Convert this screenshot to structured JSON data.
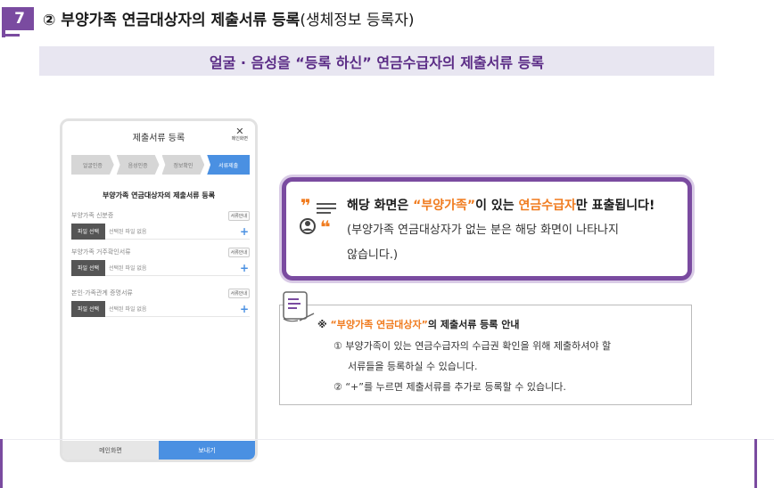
{
  "header": {
    "step_number": "7",
    "title": "② 부양가족 연금대상자의 제출서류 등록",
    "title_suffix": "(생체정보 등록자)"
  },
  "banner": {
    "text": "얼굴 · 음성을 “등록 하신” 연금수급자의 제출서류 등록"
  },
  "phone": {
    "header_title": "제출서류 등록",
    "close_label": "메인화면",
    "steps": [
      "얼굴인증",
      "음성인증",
      "정보확인",
      "서류제출"
    ],
    "form_title": "부양가족 연금대상자의 제출서류 등록",
    "guide_label": "서류안내",
    "file_button": "파일 선택",
    "no_file": "선택된 파일 없음",
    "plus": "+",
    "documents": [
      {
        "label": "부양가족 신분증"
      },
      {
        "label": "부양가족 거주확인서류"
      },
      {
        "label": "본인·가족관계 증명서류"
      }
    ],
    "footer_main": "메인화면",
    "footer_send": "보내기"
  },
  "notice": {
    "line1_a": "해당 화면은 ",
    "line1_hl1": "“부양가족”",
    "line1_b": "이 있는 ",
    "line1_hl2": "연금수급자",
    "line1_c": "만 표출됩니다!",
    "line2": "(부양가족 연금대상자가 없는 분은 해당 화면이 나타나지",
    "line3": "않습니다.)"
  },
  "info": {
    "title_prefix": "※ ",
    "title_hl": "“부양가족 연금대상자”",
    "title_suffix": "의 제출서류 등록 안내",
    "item1": "① 부양가족이 있는 연금수급자의 수급권 확인을 위해 제출하셔야 할",
    "item1_cont": "서류들을 등록하실 수 있습니다.",
    "item2": "② “+”를 누르면 제출서류를 추가로 등록할 수 있습니다."
  },
  "colors": {
    "accent": "#7a4ba0",
    "highlight": "#f07b1e",
    "phone_blue": "#4a90e2"
  }
}
